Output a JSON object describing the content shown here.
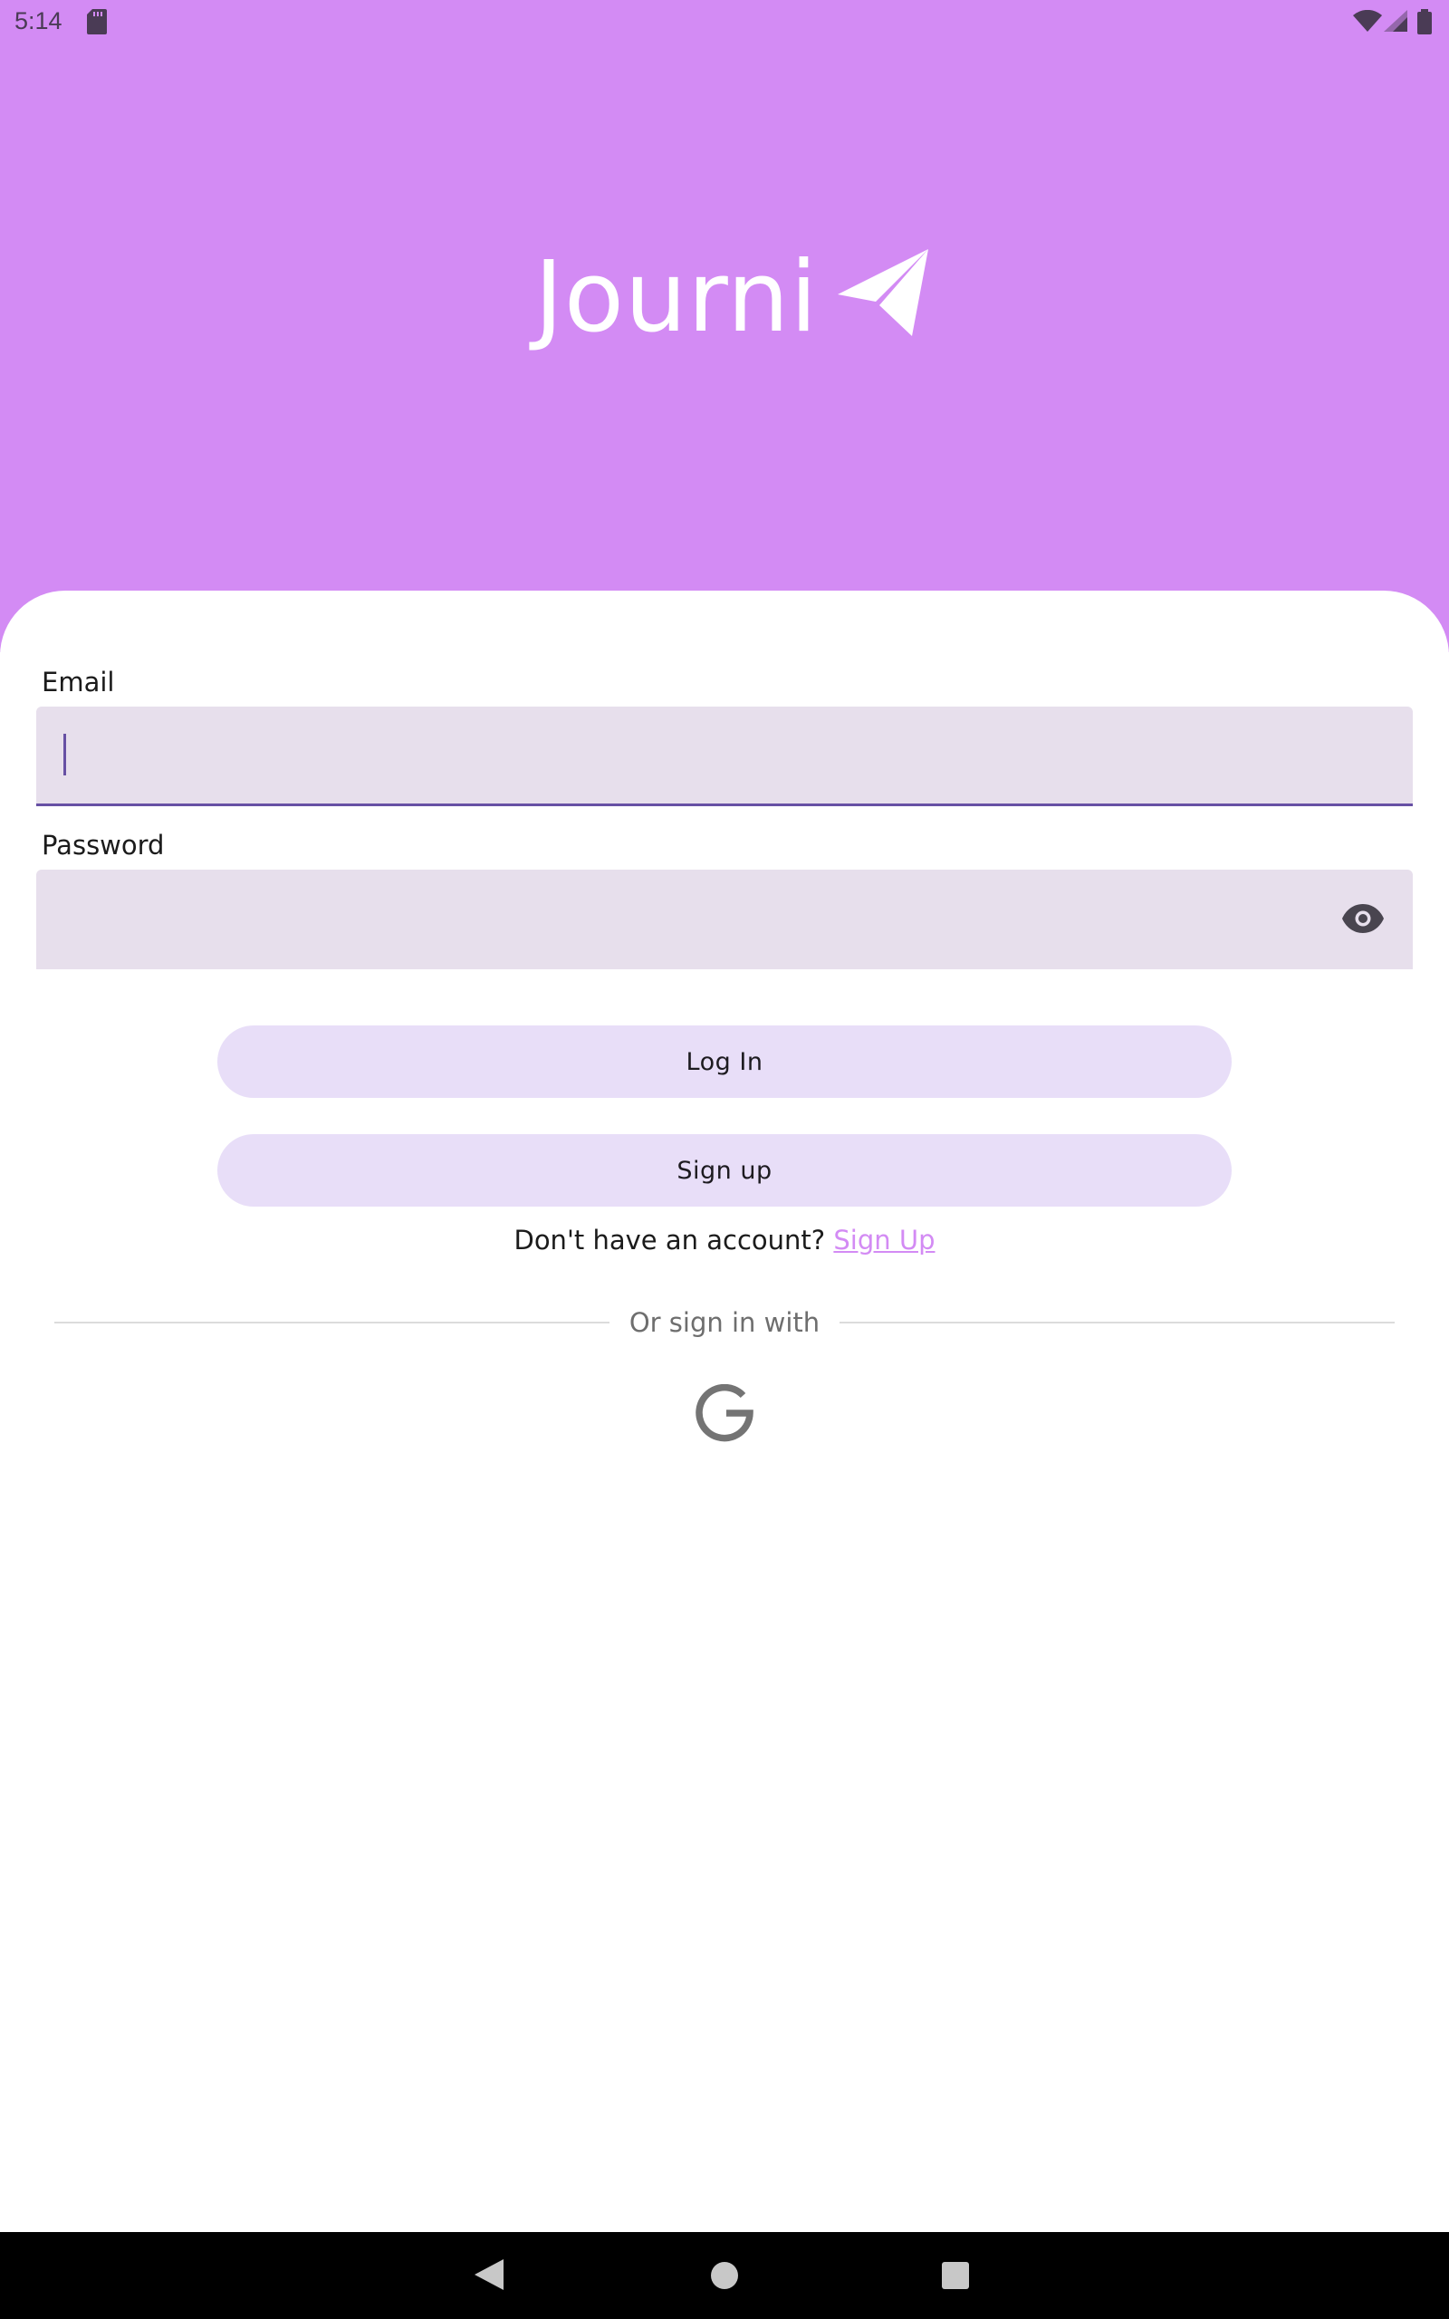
{
  "status_bar": {
    "time": "5:14",
    "icons": [
      "sd-card-icon",
      "wifi-icon",
      "signal-icon",
      "battery-icon"
    ]
  },
  "app": {
    "name": "Journi",
    "logo_icon": "paper-plane-icon"
  },
  "form": {
    "email_label": "Email",
    "email_value": "",
    "password_label": "Password",
    "password_value": "",
    "password_toggle_icon": "eye-icon"
  },
  "buttons": {
    "login": "Log In",
    "signup": "Sign up"
  },
  "account_prompt": {
    "text": "Don't have an account?",
    "link": "Sign Up"
  },
  "social": {
    "divider_text": "Or sign in with",
    "providers": [
      "google-icon"
    ]
  },
  "nav_bar": {
    "icons": [
      "back-icon",
      "home-icon",
      "recents-icon"
    ]
  },
  "colors": {
    "header": "#d38bf4",
    "field_bg": "#e7dfec",
    "focus": "#6750a4",
    "button_bg": "#e8def8",
    "link": "#d38bf4"
  }
}
